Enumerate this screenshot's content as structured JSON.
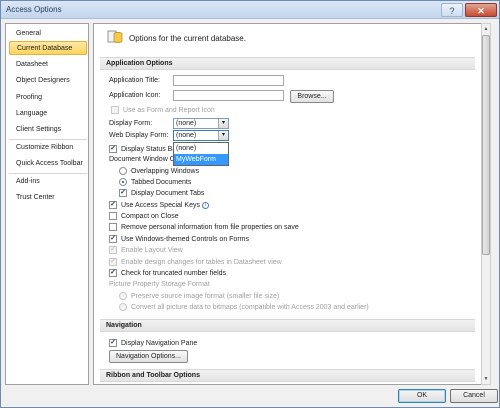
{
  "window": {
    "title": "Access Options",
    "help_glyph": "?",
    "close_glyph": "✕"
  },
  "sidebar": {
    "items": [
      {
        "label": "General"
      },
      {
        "label": "Current Database"
      },
      {
        "label": "Datasheet"
      },
      {
        "label": "Object Designers"
      },
      {
        "label": "Proofing"
      },
      {
        "label": "Language"
      },
      {
        "label": "Client Settings"
      },
      {
        "label": "Customize Ribbon"
      },
      {
        "label": "Quick Access Toolbar"
      },
      {
        "label": "Add-ins"
      },
      {
        "label": "Trust Center"
      }
    ],
    "selected_index": 1
  },
  "main": {
    "header": "Options for the current database.",
    "sections": {
      "app_options": "Application Options",
      "navigation": "Navigation",
      "ribbon": "Ribbon and Toolbar Options"
    },
    "app_title_label": "Application Title:",
    "app_title_value": "",
    "app_icon_label": "Application Icon:",
    "app_icon_value": "",
    "browse_label": "Browse...",
    "use_as_form_icon": "Use as Form and Report Icon",
    "display_form_label": "Display Form:",
    "display_form_value": "(none)",
    "web_display_form_label": "Web Display Form:",
    "web_display_form_value": "(none)",
    "dropdown_options": [
      "(none)",
      "MyWebForm"
    ],
    "dropdown_highlighted": "MyWebForm",
    "display_status_bar": "Display Status Ba",
    "document_window": "Document Window O",
    "overlapping_windows": "Overlapping Windows",
    "tabbed_documents": "Tabbed Documents",
    "display_document_tabs": "Display Document Tabs",
    "use_access_special_keys": "Use Access Special Keys",
    "info_glyph": "i",
    "compact_on_close": "Compact on Close",
    "remove_personal_info": "Remove personal information from file properties on save",
    "use_windows_themed": "Use Windows-themed Controls on Forms",
    "enable_layout_view": "Enable Layout View",
    "enable_design_changes": "Enable design changes for tables in Datasheet view",
    "check_truncated": "Check for truncated number fields",
    "picture_storage": "Picture Property Storage Format",
    "preserve_source": "Preserve source image format (smaller file size)",
    "convert_bitmaps": "Convert all picture data to bitmaps (compatible with Access 2003 and earlier)",
    "display_nav_pane": "Display Navigation Pane",
    "nav_options_label": "Navigation Options...",
    "check_glyph": "✓",
    "arrow_glyph": "▾"
  },
  "scrollbar": {
    "up": "▲",
    "down": "▼"
  },
  "footer": {
    "ok": "OK",
    "cancel": "Cancel"
  }
}
